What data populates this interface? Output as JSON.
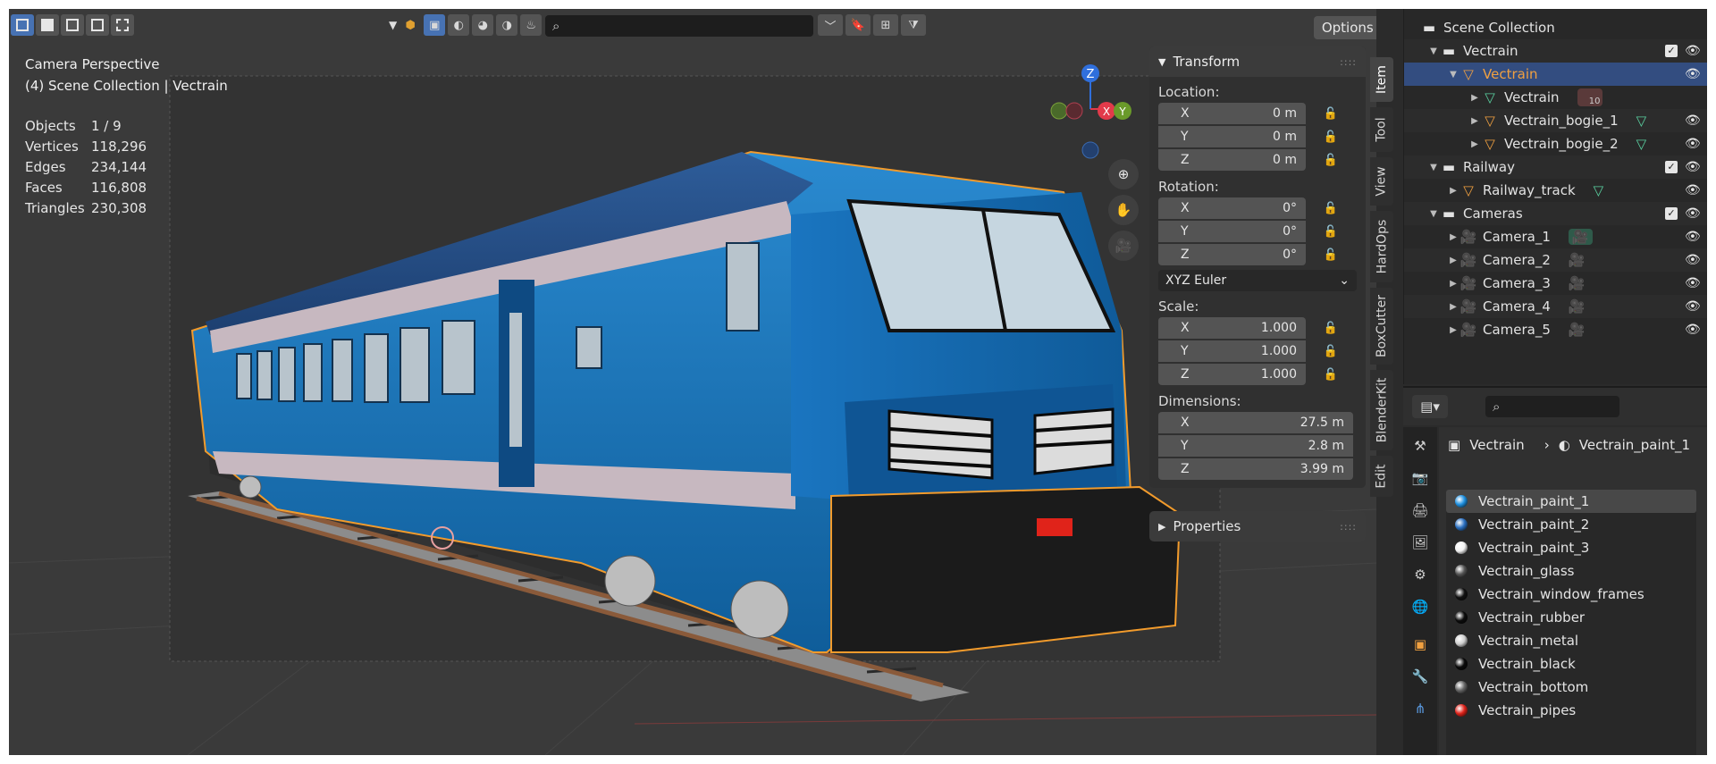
{
  "viewport": {
    "header": {
      "search_placeholder": "",
      "options_label": "Options"
    },
    "info": {
      "line1": "Camera Perspective",
      "line2": "(4) Scene Collection | Vectrain"
    },
    "stats": [
      {
        "label": "Objects",
        "value": "1 / 9"
      },
      {
        "label": "Vertices",
        "value": "118,296"
      },
      {
        "label": "Edges",
        "value": "234,144"
      },
      {
        "label": "Faces",
        "value": "116,808"
      },
      {
        "label": "Triangles",
        "value": "230,308"
      }
    ],
    "gizmo": {
      "z": "Z",
      "x": "X",
      "y": "Y"
    }
  },
  "npanel": {
    "transform_title": "Transform",
    "location_label": "Location:",
    "location": [
      {
        "axis": "X",
        "value": "0 m"
      },
      {
        "axis": "Y",
        "value": "0 m"
      },
      {
        "axis": "Z",
        "value": "0 m"
      }
    ],
    "rotation_label": "Rotation:",
    "rotation": [
      {
        "axis": "X",
        "value": "0°"
      },
      {
        "axis": "Y",
        "value": "0°"
      },
      {
        "axis": "Z",
        "value": "0°"
      }
    ],
    "rotation_mode": "XYZ Euler",
    "scale_label": "Scale:",
    "scale": [
      {
        "axis": "X",
        "value": "1.000"
      },
      {
        "axis": "Y",
        "value": "1.000"
      },
      {
        "axis": "Z",
        "value": "1.000"
      }
    ],
    "dimensions_label": "Dimensions:",
    "dimensions": [
      {
        "axis": "X",
        "value": "27.5 m"
      },
      {
        "axis": "Y",
        "value": "2.8 m"
      },
      {
        "axis": "Z",
        "value": "3.99 m"
      }
    ],
    "properties_title": "Properties"
  },
  "side_tabs": [
    "Item",
    "Tool",
    "View",
    "HardOps",
    "BoxCutter",
    "BlenderKit",
    "Edit"
  ],
  "outliner": {
    "rows": [
      {
        "label": "Scene Collection"
      },
      {
        "label": "Vectrain"
      },
      {
        "label": "Vectrain"
      },
      {
        "label": "Vectrain",
        "badge": "10"
      },
      {
        "label": "Vectrain_bogie_1"
      },
      {
        "label": "Vectrain_bogie_2"
      },
      {
        "label": "Railway"
      },
      {
        "label": "Railway_track"
      },
      {
        "label": "Cameras"
      },
      {
        "label": "Camera_1"
      },
      {
        "label": "Camera_2"
      },
      {
        "label": "Camera_3"
      },
      {
        "label": "Camera_4"
      },
      {
        "label": "Camera_5"
      }
    ]
  },
  "properties_editor": {
    "search_placeholder": "",
    "breadcrumb_object": "Vectrain",
    "breadcrumb_material": "Vectrain_paint_1",
    "materials": [
      {
        "name": "Vectrain_paint_1",
        "color": "#1e90e0"
      },
      {
        "name": "Vectrain_paint_2",
        "color": "#2a6fc0"
      },
      {
        "name": "Vectrain_paint_3",
        "color": "#f2f2f2"
      },
      {
        "name": "Vectrain_glass",
        "color": "#555555"
      },
      {
        "name": "Vectrain_window_frames",
        "color": "#111111"
      },
      {
        "name": "Vectrain_rubber",
        "color": "#0c0c0c"
      },
      {
        "name": "Vectrain_metal",
        "color": "#cfcfcf"
      },
      {
        "name": "Vectrain_black",
        "color": "#0a0a0a"
      },
      {
        "name": "Vectrain_bottom",
        "color": "#666666"
      },
      {
        "name": "Vectrain_pipes",
        "color": "#e0231a"
      }
    ]
  }
}
